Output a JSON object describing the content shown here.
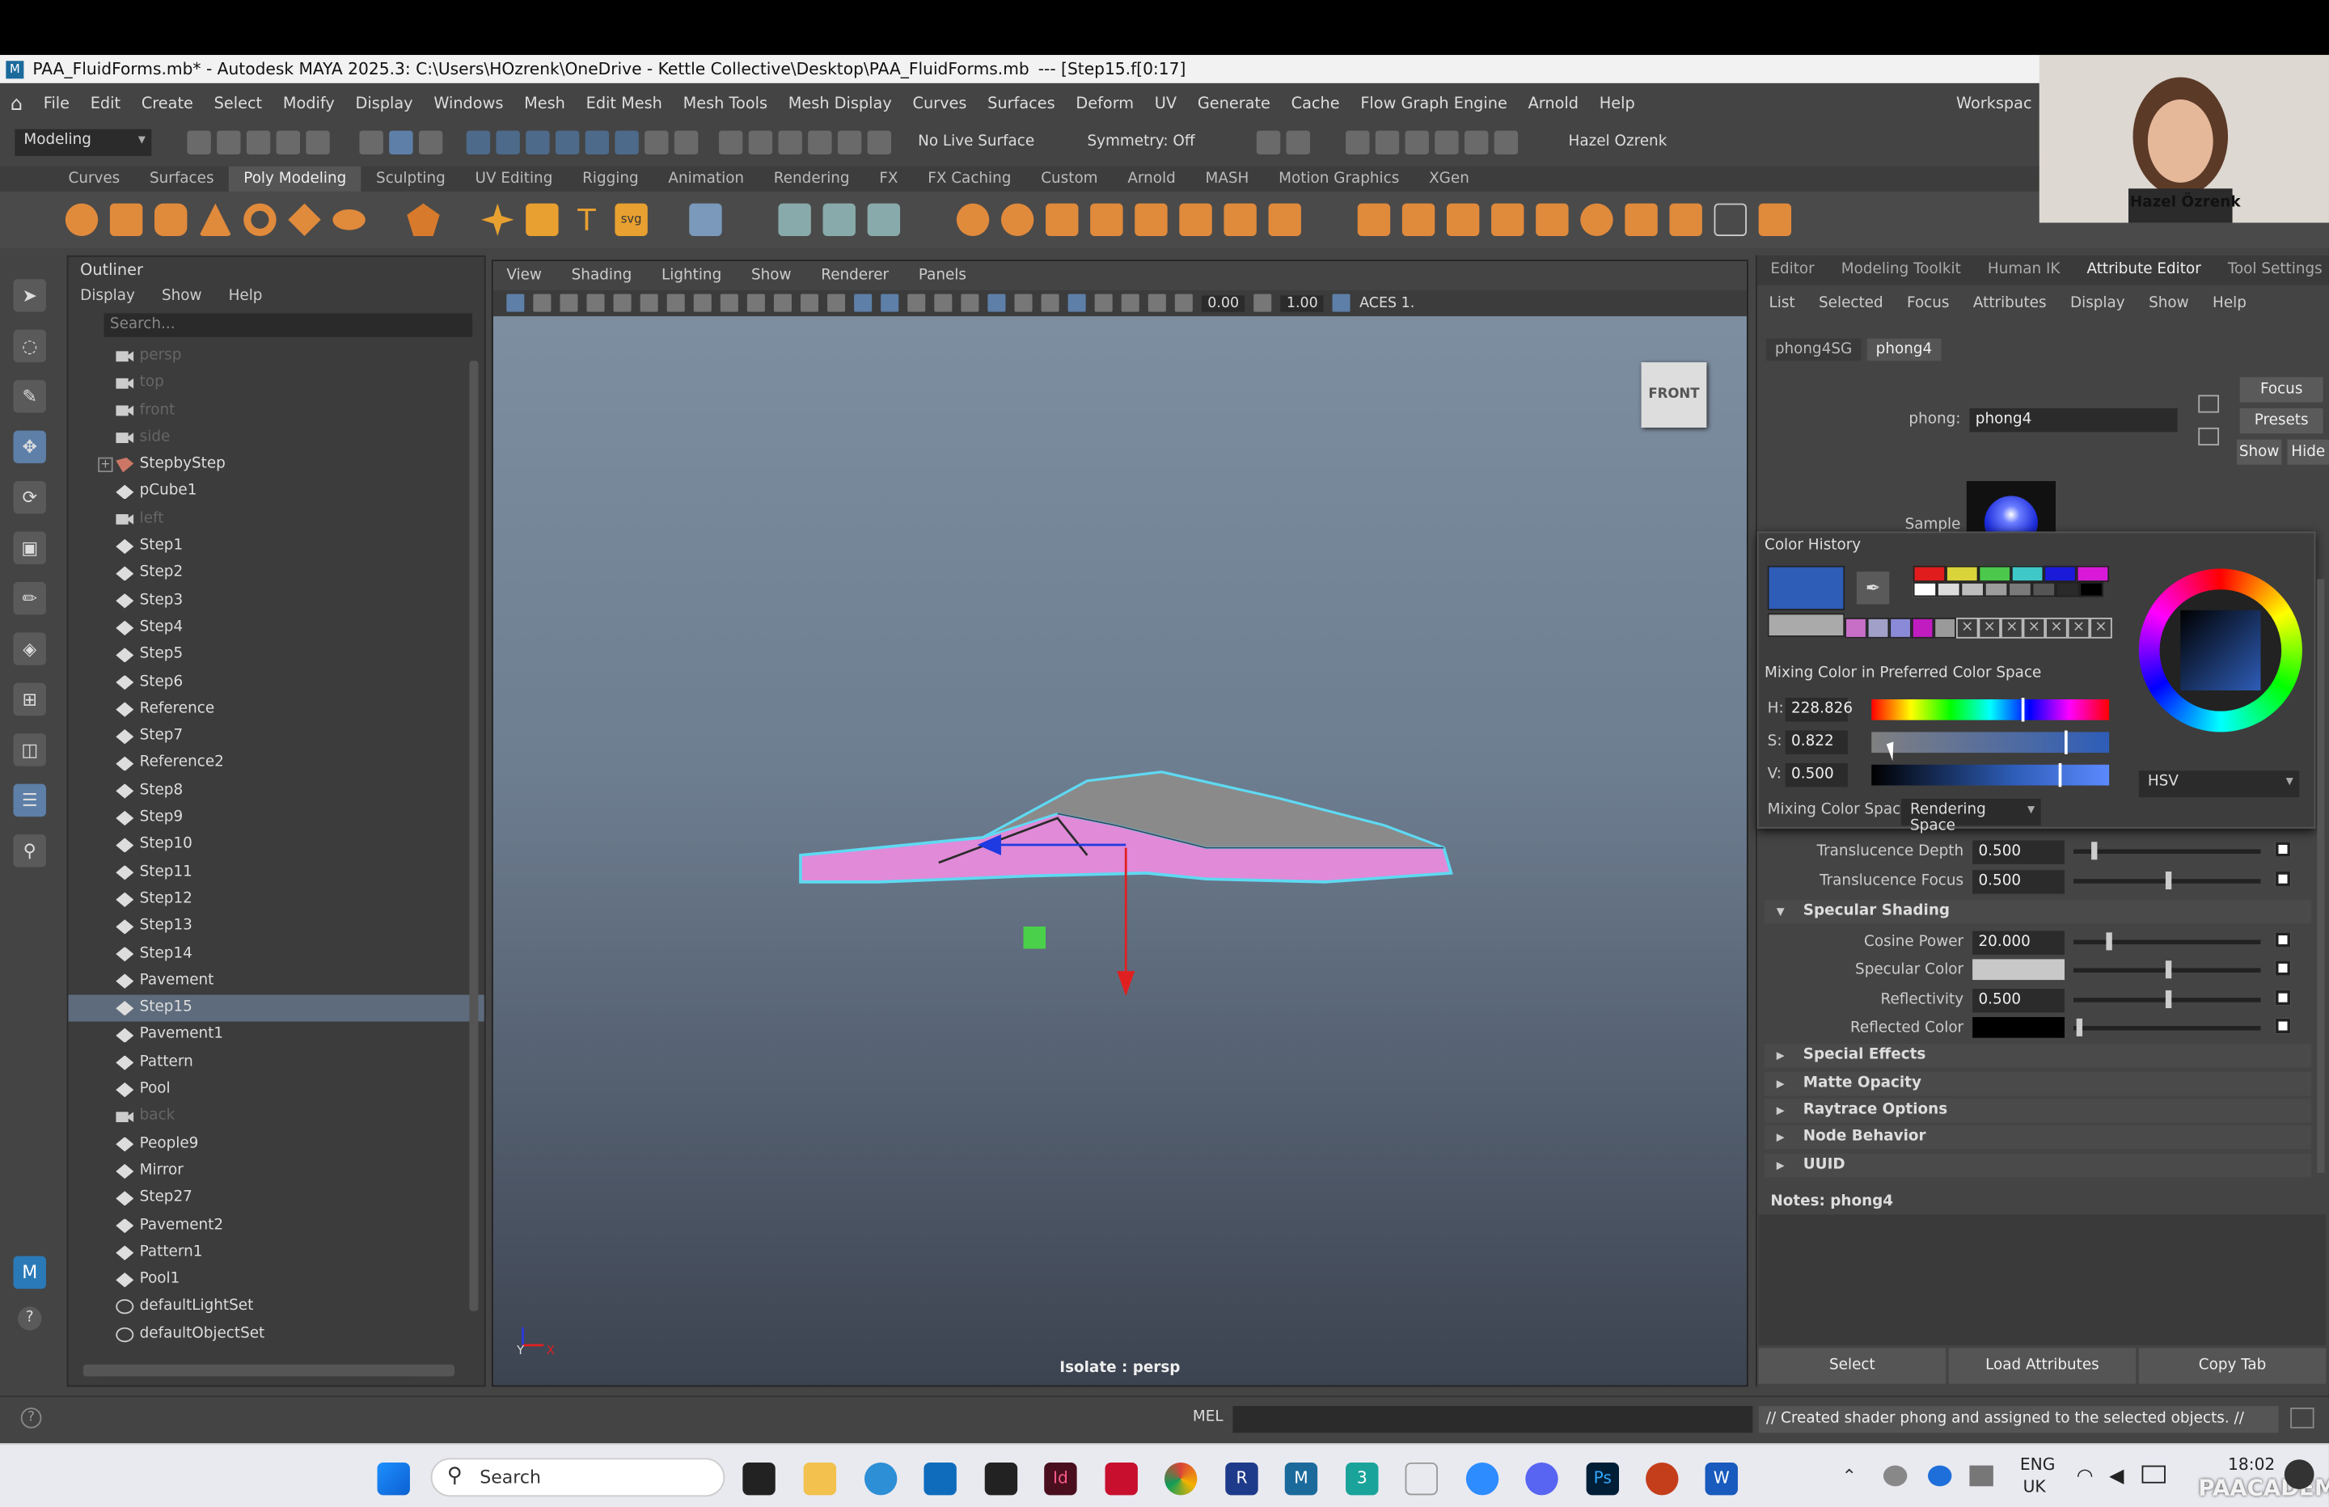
{
  "window": {
    "title": "PAA_FluidForms.mb* - Autodesk MAYA 2025.3: C:\\Users\\HOzrenk\\OneDrive - Kettle Collective\\Desktop\\PAA_FluidForms.mb",
    "frame_info": "---   [Step15.f[0:17]"
  },
  "menubar": [
    "File",
    "Edit",
    "Create",
    "Select",
    "Modify",
    "Display",
    "Windows",
    "Mesh",
    "Edit Mesh",
    "Mesh Tools",
    "Mesh Display",
    "Curves",
    "Surfaces",
    "Deform",
    "UV",
    "Generate",
    "Cache",
    "Flow Graph Engine",
    "Arnold",
    "Help"
  ],
  "menubar_right": "Workspac",
  "status_line": {
    "mode": "Modeling",
    "live_surface": "No Live Surface",
    "symmetry": "Symmetry: Off",
    "user": "Hazel Ozrenk"
  },
  "shelf_tabs": [
    "Curves",
    "Surfaces",
    "Poly Modeling",
    "Sculpting",
    "UV Editing",
    "Rigging",
    "Animation",
    "Rendering",
    "FX",
    "FX Caching",
    "Custom",
    "Arnold",
    "MASH",
    "Motion Graphics",
    "XGen"
  ],
  "shelf_active": "Poly Modeling",
  "webcam": {
    "name": "Hazel Özrenk"
  },
  "outliner": {
    "title": "Outliner",
    "menu": [
      "Display",
      "Show",
      "Help"
    ],
    "search_placeholder": "Search...",
    "items": [
      {
        "label": "persp",
        "type": "cam",
        "dim": true
      },
      {
        "label": "top",
        "type": "cam",
        "dim": true
      },
      {
        "label": "front",
        "type": "cam",
        "dim": true
      },
      {
        "label": "side",
        "type": "cam",
        "dim": true
      },
      {
        "label": "StepbyStep",
        "type": "grp",
        "dim": false,
        "expand": true
      },
      {
        "label": "pCube1",
        "type": "mesh",
        "dim": false
      },
      {
        "label": "left",
        "type": "cam",
        "dim": true
      },
      {
        "label": "Step1",
        "type": "mesh",
        "dim": false
      },
      {
        "label": "Step2",
        "type": "mesh",
        "dim": false
      },
      {
        "label": "Step3",
        "type": "mesh",
        "dim": false
      },
      {
        "label": "Step4",
        "type": "mesh",
        "dim": false
      },
      {
        "label": "Step5",
        "type": "mesh",
        "dim": false
      },
      {
        "label": "Step6",
        "type": "mesh",
        "dim": false
      },
      {
        "label": "Reference",
        "type": "mesh",
        "dim": false
      },
      {
        "label": "Step7",
        "type": "mesh",
        "dim": false
      },
      {
        "label": "Reference2",
        "type": "mesh",
        "dim": false
      },
      {
        "label": "Step8",
        "type": "mesh",
        "dim": false
      },
      {
        "label": "Step9",
        "type": "mesh",
        "dim": false
      },
      {
        "label": "Step10",
        "type": "mesh",
        "dim": false
      },
      {
        "label": "Step11",
        "type": "mesh",
        "dim": false
      },
      {
        "label": "Step12",
        "type": "mesh",
        "dim": false
      },
      {
        "label": "Step13",
        "type": "mesh",
        "dim": false
      },
      {
        "label": "Step14",
        "type": "mesh",
        "dim": false
      },
      {
        "label": "Pavement",
        "type": "mesh",
        "dim": false
      },
      {
        "label": "Step15",
        "type": "mesh",
        "dim": false,
        "selected": true
      },
      {
        "label": "Pavement1",
        "type": "mesh",
        "dim": false
      },
      {
        "label": "Pattern",
        "type": "mesh",
        "dim": false
      },
      {
        "label": "Pool",
        "type": "mesh",
        "dim": false
      },
      {
        "label": "back",
        "type": "cam",
        "dim": true
      },
      {
        "label": "People9",
        "type": "mesh",
        "dim": false
      },
      {
        "label": "Mirror",
        "type": "mesh",
        "dim": false
      },
      {
        "label": "Step27",
        "type": "mesh",
        "dim": false
      },
      {
        "label": "Pavement2",
        "type": "mesh",
        "dim": false
      },
      {
        "label": "Pattern1",
        "type": "mesh",
        "dim": false
      },
      {
        "label": "Pool1",
        "type": "mesh",
        "dim": false
      },
      {
        "label": "defaultLightSet",
        "type": "set",
        "dim": false
      },
      {
        "label": "defaultObjectSet",
        "type": "set",
        "dim": false
      }
    ]
  },
  "viewport": {
    "menu": [
      "View",
      "Shading",
      "Lighting",
      "Show",
      "Renderer",
      "Panels"
    ],
    "gamma": "0.00",
    "exposure": "1.00",
    "colorspace": "ACES 1.",
    "view_cube": "FRONT",
    "isolate_label": "Isolate : persp",
    "axis_y": "Y",
    "axis_x": "X"
  },
  "attribute_editor": {
    "tabs": [
      "Editor",
      "Modeling Toolkit",
      "Human IK",
      "Attribute Editor",
      "Tool Settings"
    ],
    "active_tab": "Attribute Editor",
    "menu": [
      "List",
      "Selected",
      "Focus",
      "Attributes",
      "Display",
      "Show",
      "Help"
    ],
    "node_tabs": [
      "phong4SG",
      "phong4"
    ],
    "phong_label": "phong:",
    "phong_value": "phong4",
    "side_buttons": [
      "Focus",
      "Presets",
      "Show",
      "Hide"
    ],
    "sample_label": "Sample",
    "color_picker": {
      "history_title": "Color History",
      "mixing_title": "Mixing Color in Preferred Color Space",
      "h_label": "H:",
      "h_value": "228.826",
      "s_label": "S:",
      "s_value": "0.822",
      "v_label": "V:",
      "v_value": "0.500",
      "mode": "HSV",
      "mixing_space_label": "Mixing Color Space:",
      "mixing_space_value": "Rendering Space",
      "current_color": "#2e5db8",
      "history_colors_top": [
        "#e01c1c",
        "#d8d43a",
        "#4cc84c",
        "#3fc8c8",
        "#1a1ad8",
        "#d81ad8"
      ],
      "history_colors_row2": [
        "#ffffff",
        "#dcdcdc",
        "#bdbdbd",
        "#9c9c9c",
        "#7a7a7a",
        "#555555",
        "#2a2a2a",
        "#000000"
      ],
      "history_colors_row3": [
        "#c76fc7",
        "#a0a0c8",
        "#8a8ad8",
        "#c01cc0",
        "#9a9a9a"
      ]
    },
    "rows": {
      "translucence_depth": {
        "label": "Translucence Depth",
        "value": "0.500"
      },
      "translucence_focus": {
        "label": "Translucence Focus",
        "value": "0.500"
      },
      "specular_section": "Specular Shading",
      "cosine_power": {
        "label": "Cosine Power",
        "value": "20.000"
      },
      "specular_color": {
        "label": "Specular Color"
      },
      "reflectivity": {
        "label": "Reflectivity",
        "value": "0.500"
      },
      "reflected_color": {
        "label": "Reflected Color"
      }
    },
    "collapsed_sections": [
      "Special Effects",
      "Matte Opacity",
      "Raytrace Options",
      "Node Behavior",
      "UUID"
    ],
    "notes_label": "Notes:  phong4",
    "bottom_buttons": [
      "Select",
      "Load Attributes",
      "Copy Tab"
    ]
  },
  "command_line": {
    "lang": "MEL",
    "result": "// Created shader phong and assigned to the selected objects. //"
  },
  "taskbar": {
    "search_label": "Search",
    "lang": "ENG",
    "region": "UK",
    "time": "18:02",
    "watermark": "PAACADEMY"
  }
}
